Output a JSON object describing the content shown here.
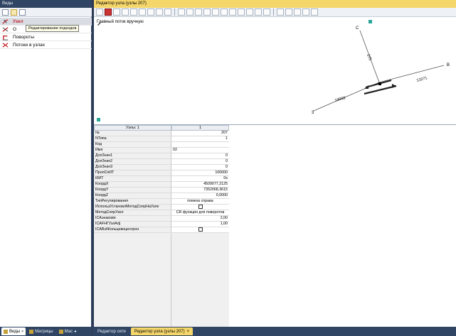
{
  "left_pane": {
    "title": "Виды",
    "tree": [
      {
        "label": "Узел",
        "icon": "node-icon",
        "header": true
      },
      {
        "label": "О",
        "icon": "node-icon"
      },
      {
        "label": "Повороты",
        "icon": "turns-icon"
      },
      {
        "label": "Потоки в узлах",
        "icon": "flows-icon"
      }
    ],
    "tooltip": "Редактирование подходов",
    "tabs": [
      {
        "label": "Виды",
        "active": true,
        "close": "×"
      },
      {
        "label": "Матрицы",
        "active": false
      },
      {
        "label": "Мас",
        "active": false
      }
    ],
    "tab_more": "◂"
  },
  "main": {
    "title": "Редактор узла (узлы 207)",
    "canvas_hint": "Главный поток вручную",
    "graph": {
      "labels": [
        {
          "text": "C"
        },
        {
          "text": "B"
        },
        {
          "text": "3"
        },
        {
          "text": "275"
        },
        {
          "text": "19068"
        },
        {
          "text": "13271"
        }
      ]
    },
    "grid": {
      "header_name": "Узлы: 1",
      "header_value": "1",
      "rows": [
        {
          "name": "№",
          "value": "207",
          "align": "num"
        },
        {
          "name": "NТипа",
          "value": "1",
          "align": "num"
        },
        {
          "name": "Код",
          "value": "",
          "align": "num"
        },
        {
          "name": "Имя",
          "value": "02",
          "align": "left"
        },
        {
          "name": "ДопЗнач1",
          "value": "0",
          "align": "num"
        },
        {
          "name": "ДопЗнач2",
          "value": "0",
          "align": "num"
        },
        {
          "name": "ДопЗнач3",
          "value": "0",
          "align": "num"
        },
        {
          "name": "ПропСпИТ",
          "value": "100000",
          "align": "num"
        },
        {
          "name": "t0ИТ",
          "value": "0s",
          "align": "num"
        },
        {
          "name": "КоордX",
          "value": "4509077,2125",
          "align": "num"
        },
        {
          "name": "КоордY",
          "value": "7352068,3615",
          "align": "num"
        },
        {
          "name": "КоордZ",
          "value": "0,0000",
          "align": "num"
        },
        {
          "name": "ТипРегулирования",
          "value": "помеха справа",
          "align": "center"
        },
        {
          "name": "ИспользУстановлМетодСопрНаУзле",
          "value": "",
          "align": "checkbox"
        },
        {
          "name": "МетодСопрУзел",
          "value": "CR функция для поворотов",
          "align": "center"
        },
        {
          "name": "ICAэнакrate",
          "value": "2,00",
          "align": "num"
        },
        {
          "name": "ICAFНГУзлАdj",
          "value": "1,00",
          "align": "num"
        },
        {
          "name": "ICAВзбКольцевоцентрон",
          "value": "",
          "align": "checkbox"
        }
      ]
    }
  },
  "bottom_tabs": [
    {
      "label": "Редактор сети",
      "active": false
    },
    {
      "label": "Редактор узла (узлы 207)",
      "active": true,
      "close": "×"
    }
  ]
}
